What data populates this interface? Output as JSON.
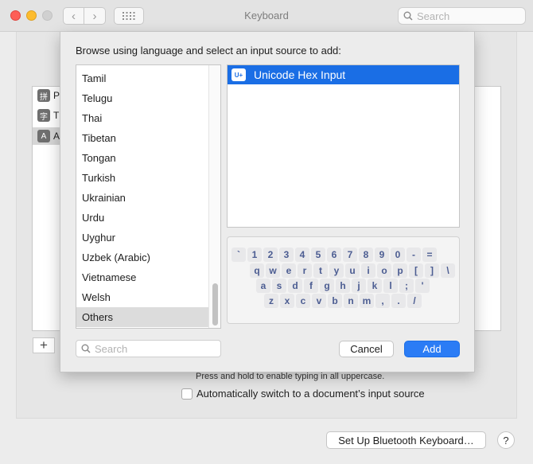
{
  "window": {
    "title": "Keyboard",
    "search_placeholder": "Search"
  },
  "background": {
    "sources": [
      {
        "icon_char": "拼",
        "label": "P"
      },
      {
        "icon_char": "字",
        "label": "T"
      },
      {
        "icon_char": "A",
        "label": "A",
        "selected": true
      }
    ],
    "add_button": "+",
    "caps_hint": "Press and hold to enable typing in all uppercase.",
    "auto_switch_label": "Automatically switch to a document’s input source",
    "bluetooth_button": "Set Up Bluetooth Keyboard…",
    "help_button": "?"
  },
  "sheet": {
    "heading": "Browse using language and select an input source to add:",
    "languages": [
      "Tamil",
      "Telugu",
      "Thai",
      "Tibetan",
      "Tongan",
      "Turkish",
      "Ukrainian",
      "Urdu",
      "Uyghur",
      "Uzbek (Arabic)",
      "Vietnamese",
      "Welsh",
      "Others"
    ],
    "selected_language": "Others",
    "input_source": {
      "icon_label": "U+",
      "label": "Unicode Hex Input"
    },
    "keyboard_rows": [
      [
        "`",
        "1",
        "2",
        "3",
        "4",
        "5",
        "6",
        "7",
        "8",
        "9",
        "0",
        "-",
        "="
      ],
      [
        "q",
        "w",
        "e",
        "r",
        "t",
        "y",
        "u",
        "i",
        "o",
        "p",
        "[",
        "]",
        "\\"
      ],
      [
        "a",
        "s",
        "d",
        "f",
        "g",
        "h",
        "j",
        "k",
        "l",
        ";",
        "'"
      ],
      [
        "z",
        "x",
        "c",
        "v",
        "b",
        "n",
        "m",
        ",",
        ".",
        "/"
      ]
    ],
    "search_placeholder": "Search",
    "cancel_button": "Cancel",
    "add_button": "Add"
  },
  "colors": {
    "accent": "#1a6ee5",
    "add_button": "#2b7cf5",
    "key_text": "#4c5d92"
  },
  "icons": [
    "search-icon",
    "chevron-left-icon",
    "chevron-right-icon",
    "grid-icon",
    "plus-icon",
    "help-icon"
  ]
}
